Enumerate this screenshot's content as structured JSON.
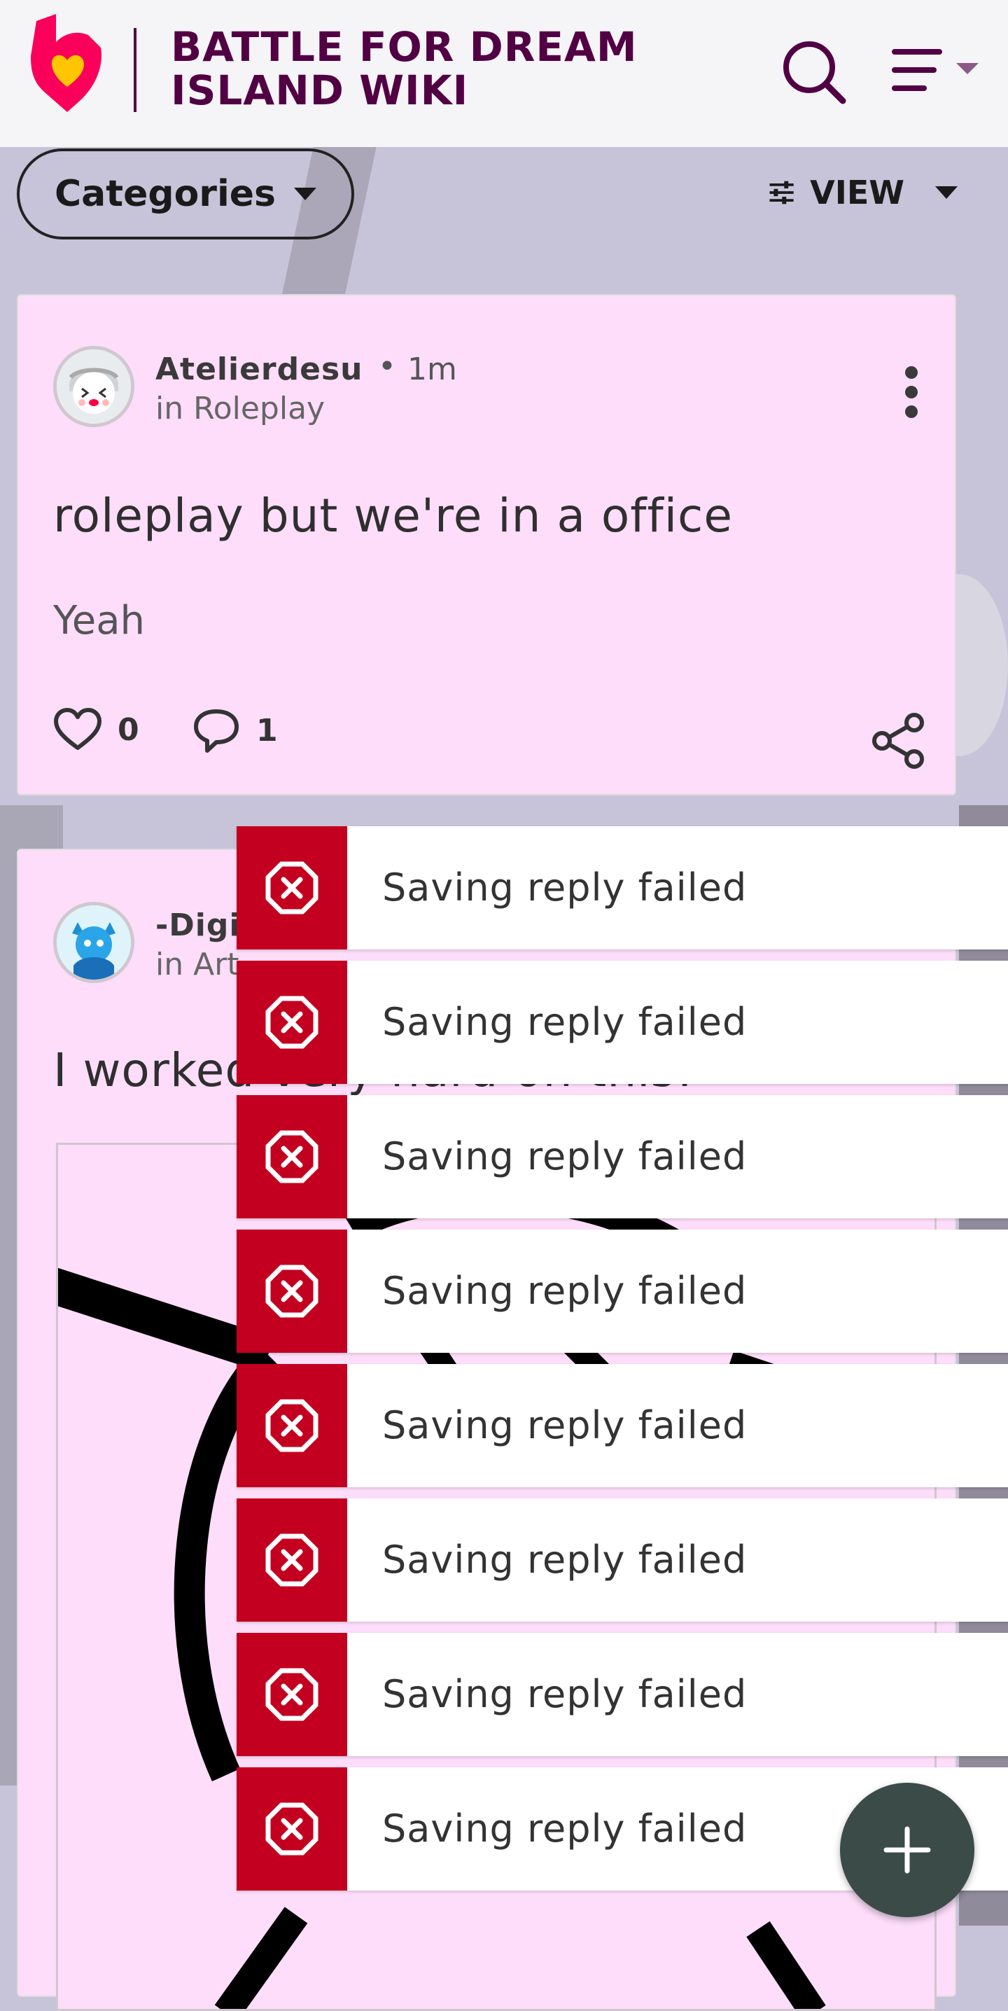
{
  "header": {
    "wiki_title_line1": "BATTLE FOR DREAM",
    "wiki_title_line2": "ISLAND WIKI",
    "brand_color": "#520044",
    "logo_icon": "fandom-heart-logo-icon",
    "search_icon": "search-icon",
    "menu_icon": "hamburger-menu-icon"
  },
  "toolbar": {
    "categories_label": "Categories",
    "view_label": "VIEW",
    "view_icon": "sliders-icon"
  },
  "posts": [
    {
      "author": "Atelierdesu",
      "time": "1m",
      "category": "in Roleplay",
      "title": "roleplay but we're in a office",
      "body": "Yeah",
      "likes": "0",
      "replies": "1"
    },
    {
      "author": "-Digi",
      "category": "in Art",
      "title": "I worked very hard on this!"
    }
  ],
  "toasts": [
    {
      "message": "Saving reply failed"
    },
    {
      "message": "Saving reply failed"
    },
    {
      "message": "Saving reply failed"
    },
    {
      "message": "Saving reply failed"
    },
    {
      "message": "Saving reply failed"
    },
    {
      "message": "Saving reply failed"
    },
    {
      "message": "Saving reply failed"
    },
    {
      "message": "Saving reply failed"
    }
  ],
  "colors": {
    "card_bg": "#fdddfa",
    "toast_error": "#c3001f",
    "fab_bg": "#3b4c48"
  },
  "fab_icon": "plus-icon"
}
